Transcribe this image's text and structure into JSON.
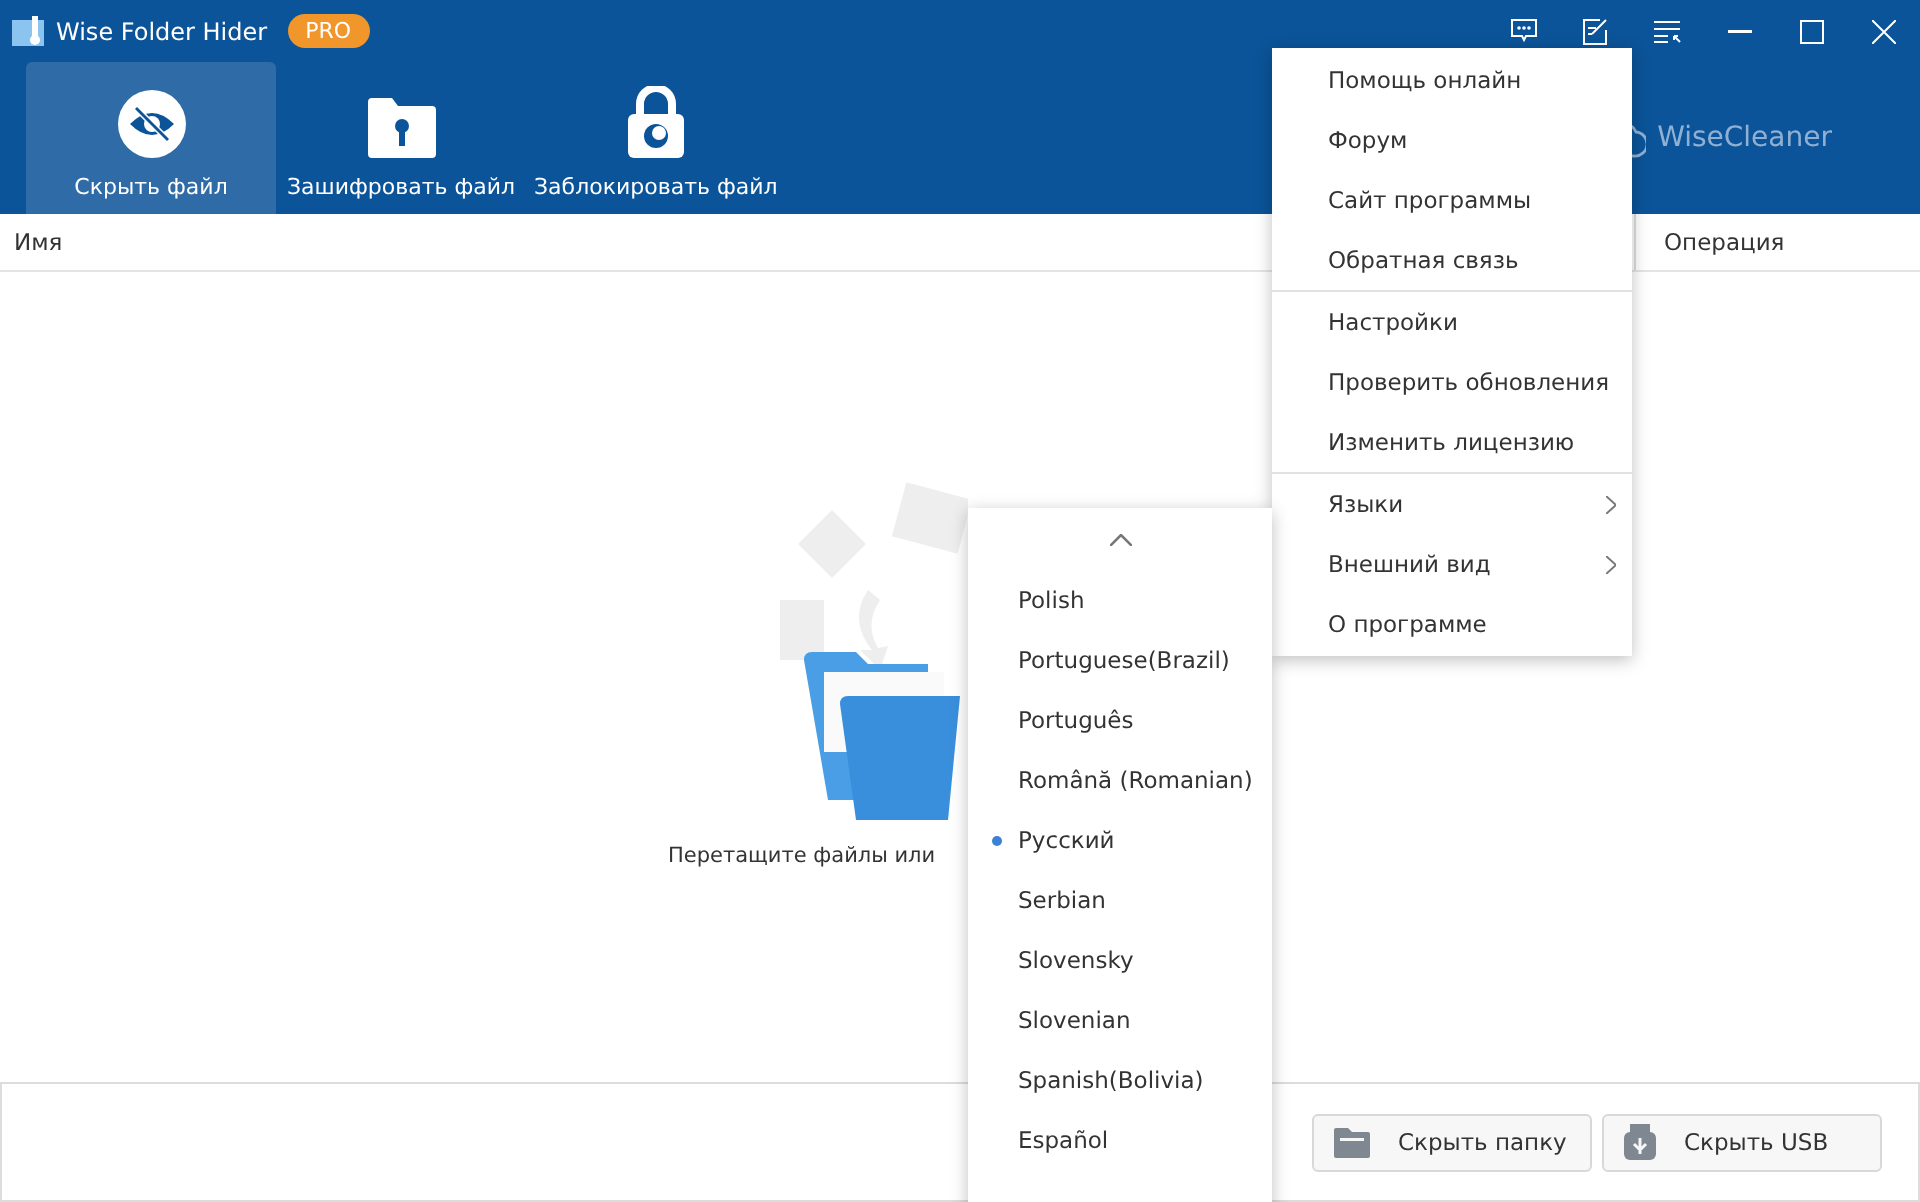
{
  "window": {
    "title": "Wise Folder Hider",
    "badge": "PRO"
  },
  "tabs": [
    {
      "label": "Скрыть файл",
      "kind": "eye",
      "selected": true
    },
    {
      "label": "Зашифровать файл",
      "kind": "folder",
      "selected": false
    },
    {
      "label": "Заблокировать файл",
      "kind": "lock",
      "selected": false
    }
  ],
  "brand": "WiseCleaner",
  "table": {
    "columns": [
      "Имя",
      "Операция"
    ]
  },
  "drop_hint": "Перетащите файлы или",
  "buttons": [
    {
      "label": "Скрыть папку",
      "kind": "folder"
    },
    {
      "label": "Скрыть USB",
      "kind": "usb"
    }
  ],
  "menu": {
    "groups": [
      [
        {
          "label": "Помощь онлайн",
          "submenu": false
        },
        {
          "label": "Форум",
          "submenu": false
        },
        {
          "label": "Сайт программы",
          "submenu": false
        },
        {
          "label": "Обратная связь",
          "submenu": false
        }
      ],
      [
        {
          "label": "Настройки",
          "submenu": false
        },
        {
          "label": "Проверить обновления",
          "submenu": false
        },
        {
          "label": "Изменить лицензию",
          "submenu": false
        }
      ],
      [
        {
          "label": "Языки",
          "submenu": true
        },
        {
          "label": "Внешний вид",
          "submenu": true
        },
        {
          "label": "О программе",
          "submenu": false
        }
      ]
    ]
  },
  "languages": [
    {
      "label": "Polish",
      "selected": false
    },
    {
      "label": "Portuguese(Brazil)",
      "selected": false
    },
    {
      "label": "Português",
      "selected": false
    },
    {
      "label": "Română (Romanian)",
      "selected": false
    },
    {
      "label": "Русский",
      "selected": true
    },
    {
      "label": "Serbian",
      "selected": false
    },
    {
      "label": "Slovensky",
      "selected": false
    },
    {
      "label": "Slovenian",
      "selected": false
    },
    {
      "label": "Spanish(Bolivia)",
      "selected": false
    },
    {
      "label": "Español",
      "selected": false
    }
  ]
}
